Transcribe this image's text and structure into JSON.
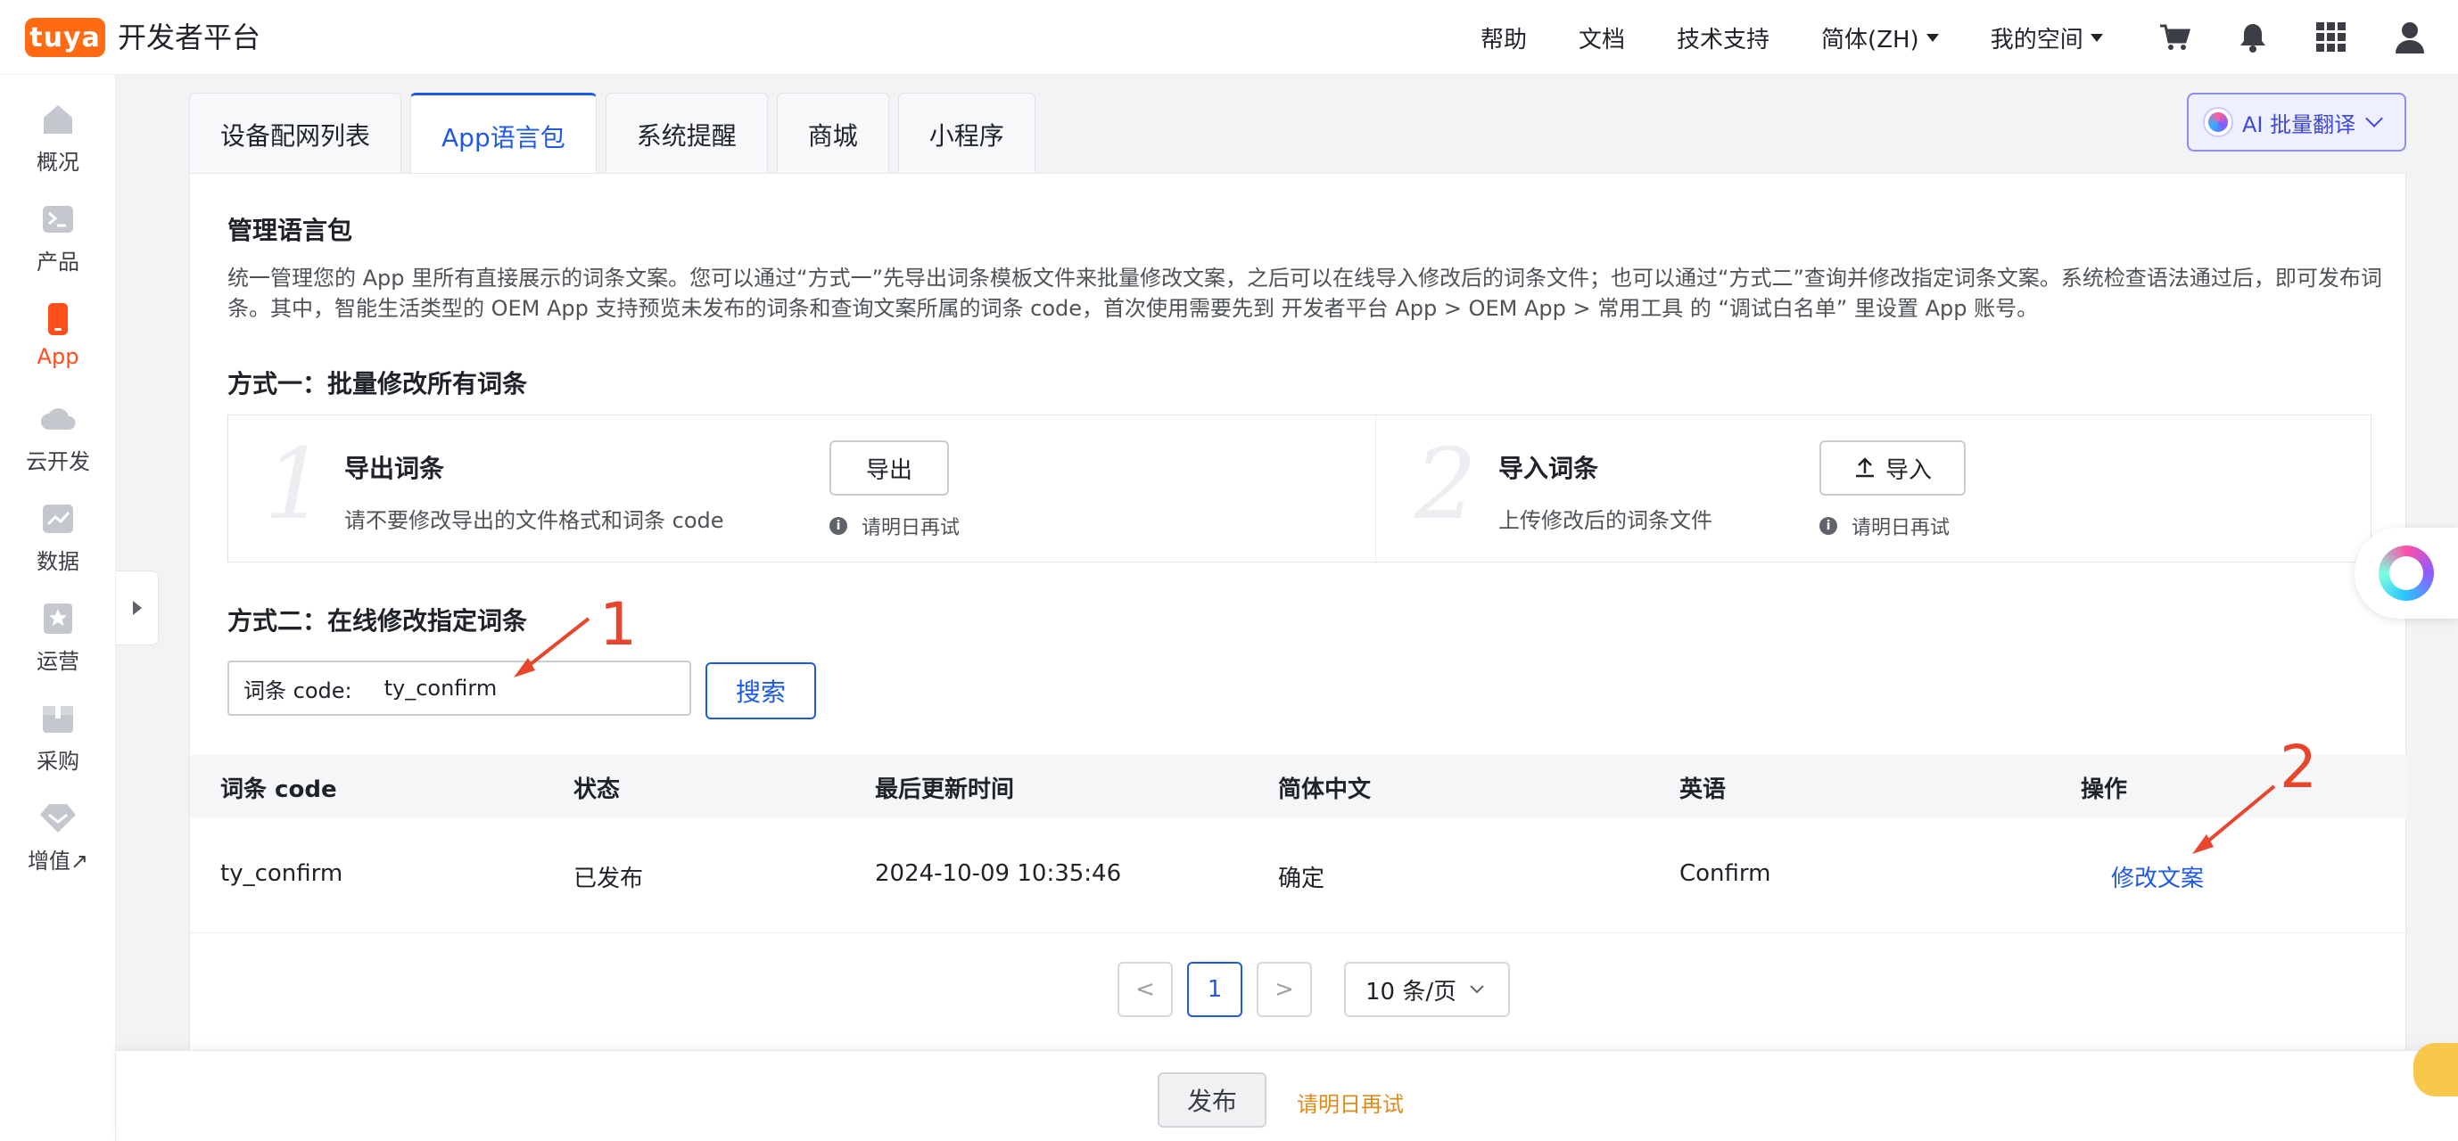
{
  "header": {
    "logo_text": "tuya",
    "title": "开发者平台",
    "nav": [
      {
        "label": "帮助"
      },
      {
        "label": "文档"
      },
      {
        "label": "技术支持"
      },
      {
        "label": "简体(ZH)"
      },
      {
        "label": "我的空间"
      }
    ],
    "icons": [
      "cart-icon",
      "bell-icon",
      "apps-grid-icon",
      "user-icon"
    ]
  },
  "sidebar": {
    "items": [
      {
        "label": "概况",
        "icon": "home-icon"
      },
      {
        "label": "产品",
        "icon": "terminal-icon"
      },
      {
        "label": "App",
        "icon": "phone-icon",
        "active": true
      },
      {
        "label": "云开发",
        "icon": "cloud-icon"
      },
      {
        "label": "数据",
        "icon": "chart-icon"
      },
      {
        "label": "运营",
        "icon": "star-icon"
      },
      {
        "label": "采购",
        "icon": "box-icon"
      },
      {
        "label": "增值↗",
        "icon": "diamond-icon"
      }
    ]
  },
  "tabs": [
    {
      "label": "设备配网列表"
    },
    {
      "label": "App语言包",
      "active": true
    },
    {
      "label": "系统提醒"
    },
    {
      "label": "商城"
    },
    {
      "label": "小程序"
    }
  ],
  "ai_translate": {
    "label": "AI 批量翻译"
  },
  "manage": {
    "title": "管理语言包",
    "description": "统一管理您的 App 里所有直接展示的词条文案。您可以通过“方式一”先导出词条模板文件来批量修改文案，之后可以在线导入修改后的词条文件；也可以通过“方式二”查询并修改指定词条文案。系统检查语法通过后，即可发布词条。其中，智能生活类型的 OEM App 支持预览未发布的词条和查询文案所属的词条 code，首次使用需要先到 开发者平台 App > OEM App > 常用工具 的 “调试白名单” 里设置 App 账号。"
  },
  "method1": {
    "title": "方式一：批量修改所有词条",
    "export": {
      "num": "1",
      "title": "导出词条",
      "desc": "请不要修改导出的文件格式和词条 code",
      "button": "导出",
      "hint": "请明日再试"
    },
    "import": {
      "num": "2",
      "title": "导入词条",
      "desc": "上传修改后的词条文件",
      "button": "导入",
      "hint": "请明日再试"
    }
  },
  "method2": {
    "title": "方式二：在线修改指定词条",
    "search_label": "词条 code:",
    "search_value": "ty_confirm",
    "search_button": "搜索"
  },
  "table": {
    "columns": [
      "词条 code",
      "状态",
      "最后更新时间",
      "简体中文",
      "英语",
      "操作"
    ],
    "rows": [
      {
        "code": "ty_confirm",
        "status": "已发布",
        "updated": "2024-10-09 10:35:46",
        "zh": "确定",
        "en": "Confirm",
        "action": "修改文案"
      }
    ]
  },
  "pagination": {
    "prev": "<",
    "current": "1",
    "next": ">",
    "page_size": "10 条/页"
  },
  "footer": {
    "publish": "发布",
    "hint": "请明日再试"
  },
  "annotations": {
    "one": "1",
    "two": "2"
  },
  "colors": {
    "brand": "#ff6a13",
    "primary": "#1e5ae6",
    "active_side": "#ff4d1c",
    "warning": "#e08a1a",
    "annotation": "#e8452c"
  }
}
